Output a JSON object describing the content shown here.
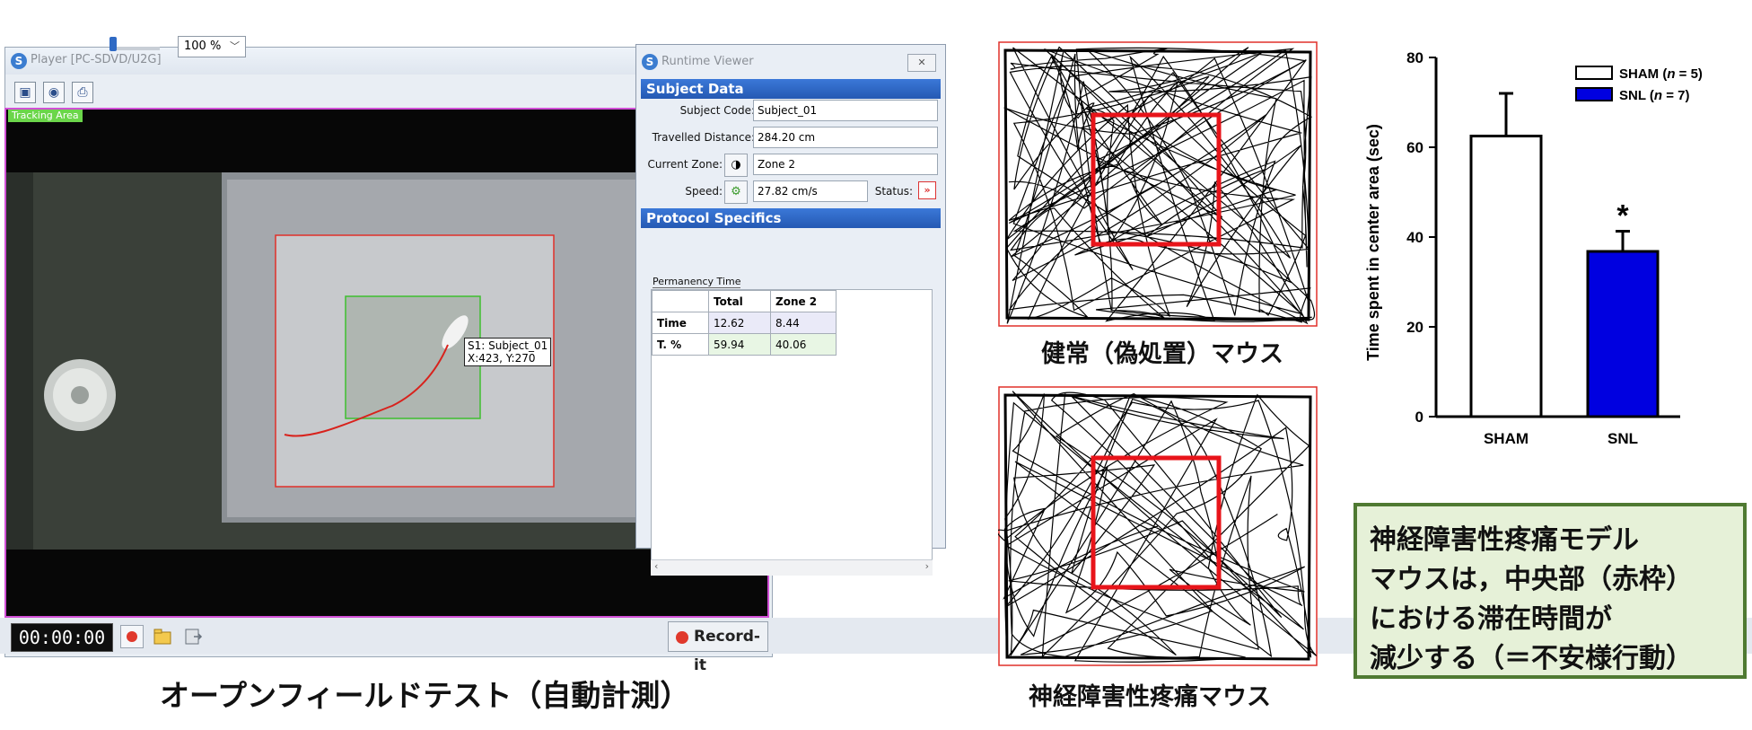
{
  "player": {
    "title": "Player [PC-SDVD/U2G]",
    "zoom_value": "100 %",
    "tracking_area_label": "Tracking Area",
    "subject_label_line1": "S1: Subject_01",
    "subject_label_line2": "X:423, Y:270",
    "timer": "00:00:00",
    "record_it_label": "Record-it"
  },
  "runtime_viewer": {
    "title": "Runtime Viewer",
    "subject_data_header": "Subject Data",
    "subject_code_label": "Subject Code:",
    "subject_code_value": "Subject_01",
    "travelled_distance_label": "Travelled Distance:",
    "travelled_distance_value": "284.20 cm",
    "current_zone_label": "Current Zone:",
    "current_zone_value": "Zone 2",
    "speed_label": "Speed:",
    "speed_value": "27.82 cm/s",
    "status_label": "Status:",
    "protocol_header": "Protocol Specifics",
    "permanency_tab": "Permanency Time",
    "table": {
      "headers": [
        "",
        "Total",
        "Zone 2"
      ],
      "rows": [
        [
          "Time",
          "12.62",
          "8.44"
        ],
        [
          "T. %",
          "59.94",
          "40.06"
        ]
      ]
    }
  },
  "captions": {
    "main": "オープンフィールドテスト（自動計測）",
    "normal_mouse": "健常（偽処置）マウス",
    "pain_mouse": "神経障害性疼痛マウス"
  },
  "chart_data": {
    "type": "bar",
    "categories": [
      "SHAM",
      "SNL"
    ],
    "values": [
      62.5,
      36.8
    ],
    "errors": [
      9.5,
      4.5
    ],
    "ylabel": "Time spent in center area (sec)",
    "ylim": [
      0,
      80
    ],
    "yticks": [
      0,
      20,
      40,
      60,
      80
    ],
    "significance": [
      "",
      "*"
    ],
    "legend": [
      {
        "label_prefix": "SHAM (",
        "label_n": "n",
        "label_suffix": " = 5)",
        "color": "#ffffff"
      },
      {
        "label_prefix": "SNL (",
        "label_n": "n",
        "label_suffix": " = 7)",
        "color": "#0000e0"
      }
    ],
    "legend_position": "top-right",
    "bar_colors": [
      "#ffffff",
      "#0000e0"
    ],
    "grid": false
  },
  "conclusion": {
    "lines": [
      "神経障害性疼痛モデル",
      "マウスは，中央部（赤枠）",
      "における滞在時間が",
      "減少する（＝不安様行動）"
    ]
  },
  "colors": {
    "tracking_frame": "#d14fd6",
    "zone_outer": "#e0302a",
    "zone_inner": "#3fbf2f",
    "center_box": "#e8141a",
    "conclusion_border": "#4f7a32",
    "conclusion_bg": "#e6f1d8"
  }
}
